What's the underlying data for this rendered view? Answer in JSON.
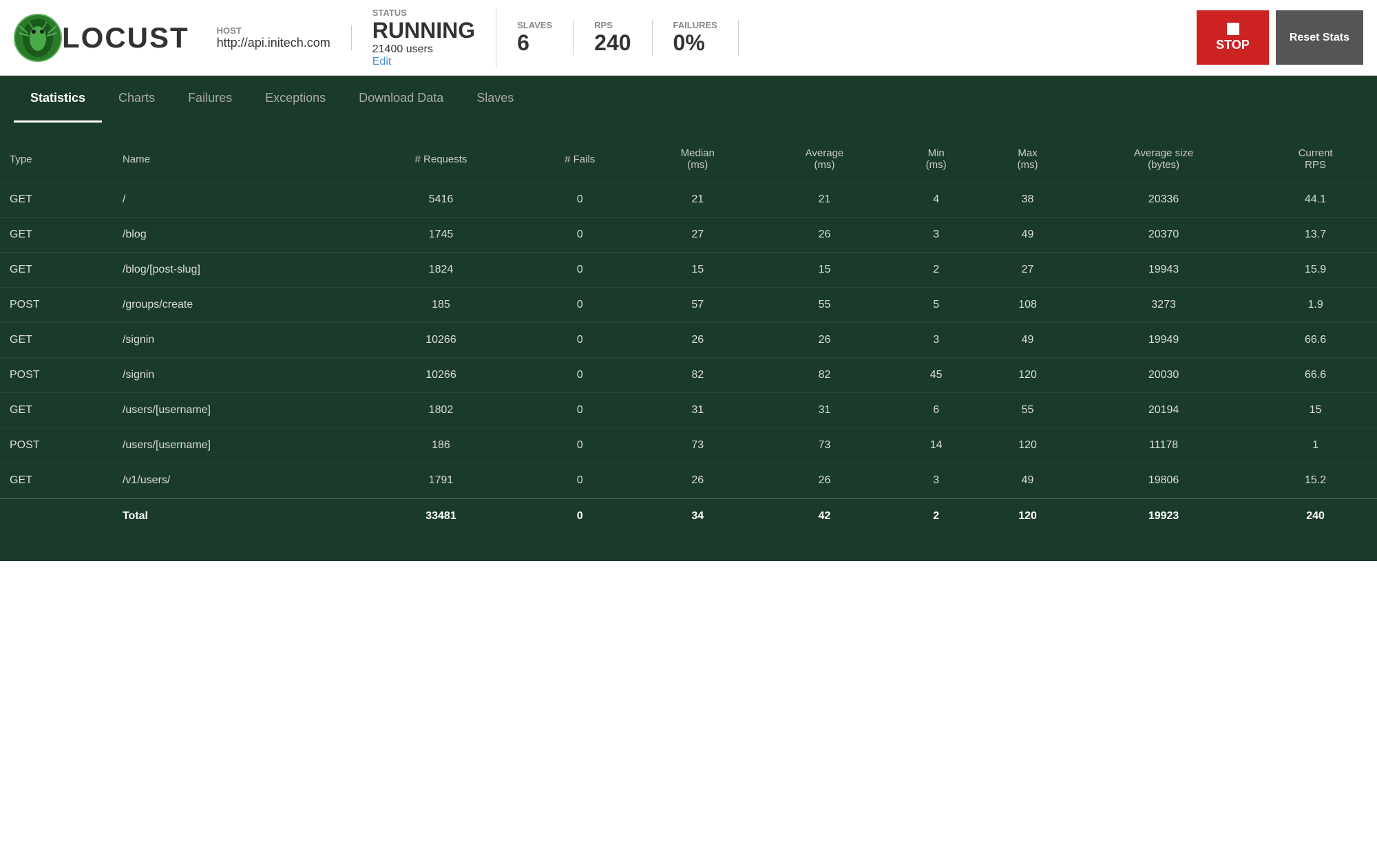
{
  "header": {
    "logo_text": "LOCUST",
    "host_label": "HOST",
    "host_value": "http://api.initech.com",
    "status_label": "STATUS",
    "status_value": "RUNNING",
    "users": "21400 users",
    "edit_label": "Edit",
    "slaves_label": "SLAVES",
    "slaves_value": "6",
    "rps_label": "RPS",
    "rps_value": "240",
    "failures_label": "FAILURES",
    "failures_value": "0%",
    "stop_label": "STOP",
    "reset_label": "Reset Stats"
  },
  "nav": {
    "items": [
      {
        "label": "Statistics",
        "active": true
      },
      {
        "label": "Charts",
        "active": false
      },
      {
        "label": "Failures",
        "active": false
      },
      {
        "label": "Exceptions",
        "active": false
      },
      {
        "label": "Download Data",
        "active": false
      },
      {
        "label": "Slaves",
        "active": false
      }
    ]
  },
  "table": {
    "columns": [
      "Type",
      "Name",
      "# Requests",
      "# Fails",
      "Median (ms)",
      "Average (ms)",
      "Min (ms)",
      "Max (ms)",
      "Average size (bytes)",
      "Current RPS"
    ],
    "rows": [
      {
        "type": "GET",
        "name": "/",
        "requests": "5416",
        "fails": "0",
        "median": "21",
        "average": "21",
        "min": "4",
        "max": "38",
        "avg_size": "20336",
        "rps": "44.1"
      },
      {
        "type": "GET",
        "name": "/blog",
        "requests": "1745",
        "fails": "0",
        "median": "27",
        "average": "26",
        "min": "3",
        "max": "49",
        "avg_size": "20370",
        "rps": "13.7"
      },
      {
        "type": "GET",
        "name": "/blog/[post-slug]",
        "requests": "1824",
        "fails": "0",
        "median": "15",
        "average": "15",
        "min": "2",
        "max": "27",
        "avg_size": "19943",
        "rps": "15.9"
      },
      {
        "type": "POST",
        "name": "/groups/create",
        "requests": "185",
        "fails": "0",
        "median": "57",
        "average": "55",
        "min": "5",
        "max": "108",
        "avg_size": "3273",
        "rps": "1.9"
      },
      {
        "type": "GET",
        "name": "/signin",
        "requests": "10266",
        "fails": "0",
        "median": "26",
        "average": "26",
        "min": "3",
        "max": "49",
        "avg_size": "19949",
        "rps": "66.6"
      },
      {
        "type": "POST",
        "name": "/signin",
        "requests": "10266",
        "fails": "0",
        "median": "82",
        "average": "82",
        "min": "45",
        "max": "120",
        "avg_size": "20030",
        "rps": "66.6"
      },
      {
        "type": "GET",
        "name": "/users/[username]",
        "requests": "1802",
        "fails": "0",
        "median": "31",
        "average": "31",
        "min": "6",
        "max": "55",
        "avg_size": "20194",
        "rps": "15"
      },
      {
        "type": "POST",
        "name": "/users/[username]",
        "requests": "186",
        "fails": "0",
        "median": "73",
        "average": "73",
        "min": "14",
        "max": "120",
        "avg_size": "11178",
        "rps": "1"
      },
      {
        "type": "GET",
        "name": "/v1/users/",
        "requests": "1791",
        "fails": "0",
        "median": "26",
        "average": "26",
        "min": "3",
        "max": "49",
        "avg_size": "19806",
        "rps": "15.2"
      }
    ],
    "total": {
      "label": "Total",
      "requests": "33481",
      "fails": "0",
      "median": "34",
      "average": "42",
      "min": "2",
      "max": "120",
      "avg_size": "19923",
      "rps": "240"
    }
  }
}
